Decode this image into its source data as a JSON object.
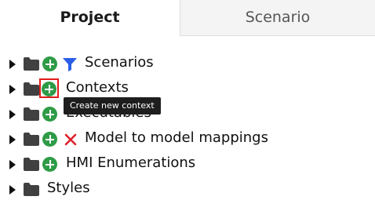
{
  "tabs": {
    "project_label": "Project",
    "scenario_label": "Scenario",
    "active": "Project"
  },
  "tree": {
    "items": [
      {
        "label": "Scenarios",
        "has_add": true,
        "marker": "filter-icon"
      },
      {
        "label": "Contexts",
        "has_add": true,
        "marker": "",
        "highlighted": true
      },
      {
        "label": "Executables",
        "has_add": true,
        "marker": ""
      },
      {
        "label": "Model to model mappings",
        "has_add": true,
        "marker": "x-icon"
      },
      {
        "label": "HMI Enumerations",
        "has_add": true,
        "marker": ""
      },
      {
        "label": "Styles",
        "has_add": false,
        "marker": ""
      }
    ]
  },
  "tooltip": {
    "text": "Create new context"
  },
  "colors": {
    "add_green": "#2e9b46",
    "highlight_red": "#e31b1b",
    "filter_blue": "#2a5ee8",
    "x_red": "#e0202a",
    "folder_gray": "#404040",
    "tooltip_bg": "#1e1e1e"
  }
}
